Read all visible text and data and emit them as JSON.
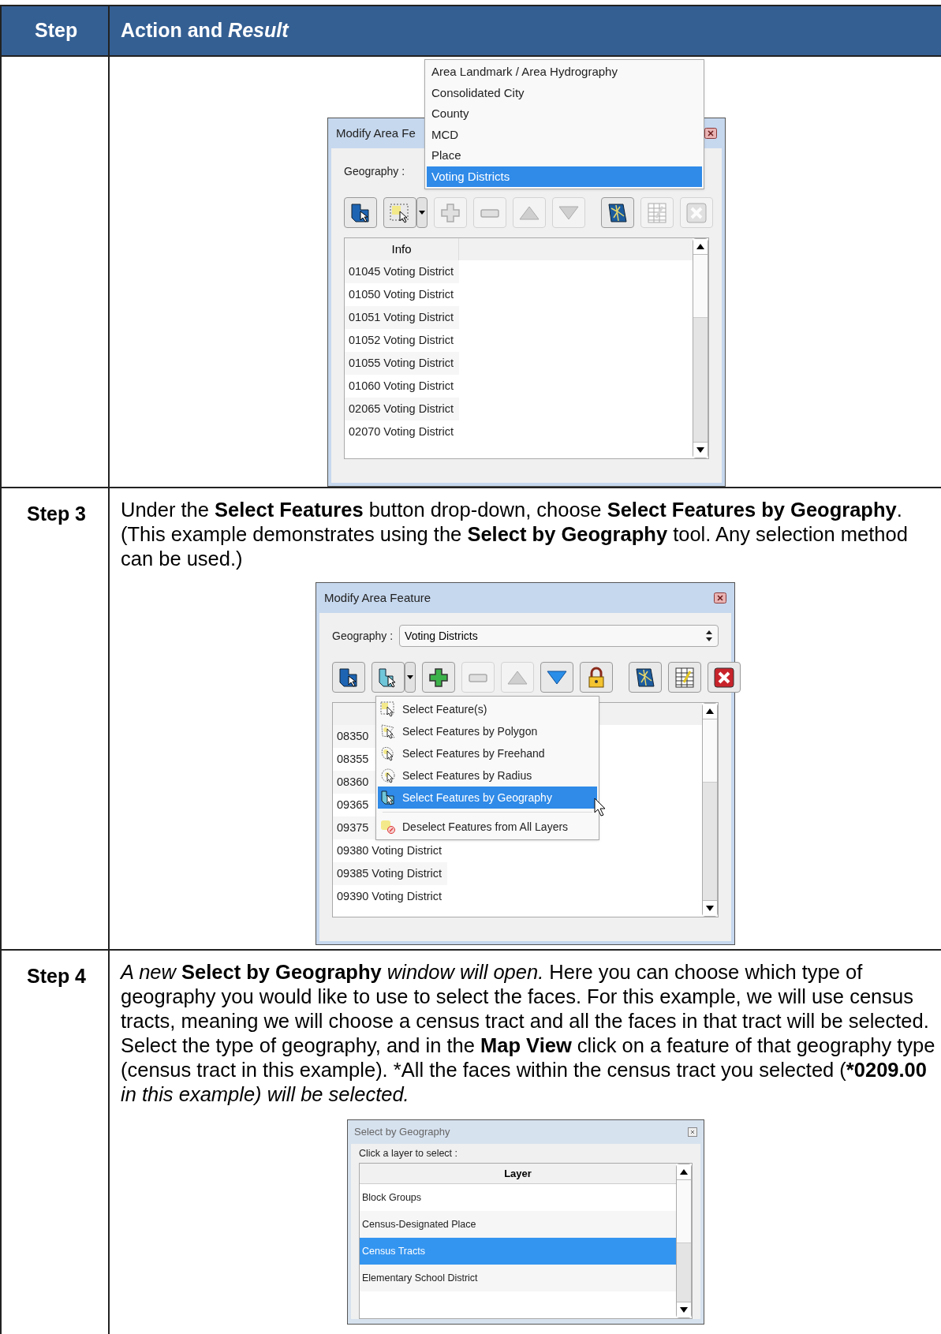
{
  "table": {
    "columns": [
      "Step",
      "Action and *Result*"
    ],
    "rows": [
      {
        "step": "",
        "window": {
          "kind": "feature",
          "title": "Modify Area Fe",
          "geography_label": "Geography :",
          "dropdown": [
            {
              "label": "Area Landmark / Area Hydrography",
              "selected": false
            },
            {
              "label": "Consolidated City",
              "selected": false
            },
            {
              "label": "County",
              "selected": false
            },
            {
              "label": "MCD",
              "selected": false
            },
            {
              "label": "Place",
              "selected": false
            },
            {
              "label": "Voting Districts",
              "selected": true
            }
          ],
          "toolbar": [
            {
              "kind": "geography",
              "disabled": false
            },
            {
              "kind": "select-box-split",
              "disabled": false
            },
            {
              "kind": "add",
              "disabled": true
            },
            {
              "kind": "remove",
              "disabled": true
            },
            {
              "kind": "up",
              "disabled": true
            },
            {
              "kind": "down",
              "disabled": true
            },
            {
              "kind": "map",
              "disabled": false
            },
            {
              "kind": "table",
              "disabled": true
            },
            {
              "kind": "delete",
              "disabled": true
            }
          ],
          "list_header": "Info",
          "list": [
            "01045 Voting District",
            "01050 Voting District",
            "01051 Voting District",
            "01052 Voting District",
            "01055 Voting District",
            "01060 Voting District",
            "02065 Voting District",
            "02070 Voting District"
          ]
        }
      },
      {
        "step": "Step 3",
        "text": "Under the **Select Features** button drop-down, choose **Select Features by Geography**. (This example demonstrates using the **Select by Geography** tool. Any selection method can be used.)",
        "window": {
          "kind": "feature",
          "title": "Modify Area Feature",
          "geography_label": "Geography :",
          "geography_value": "Voting Districts",
          "toolbar": [
            {
              "kind": "geography",
              "disabled": false
            },
            {
              "kind": "select-shape-split",
              "disabled": false
            },
            {
              "kind": "add",
              "disabled": false
            },
            {
              "kind": "remove",
              "disabled": true
            },
            {
              "kind": "up",
              "disabled": true
            },
            {
              "kind": "down",
              "disabled": false
            },
            {
              "kind": "lock",
              "disabled": false
            },
            {
              "kind": "map",
              "disabled": false
            },
            {
              "kind": "table",
              "disabled": false
            },
            {
              "kind": "delete",
              "disabled": false
            }
          ],
          "list": [
            "08350",
            "08355",
            "08360",
            "09365",
            "09375",
            "09380 Voting District",
            "09385 Voting District",
            "09390 Voting District"
          ],
          "menu": [
            {
              "kind": "box",
              "label": "Select Feature(s)",
              "selected": false
            },
            {
              "kind": "polygon",
              "label": "Select Features by Polygon",
              "selected": false
            },
            {
              "kind": "freehand",
              "label": "Select Features by Freehand",
              "selected": false
            },
            {
              "kind": "radius",
              "label": "Select Features by Radius",
              "selected": false
            },
            {
              "kind": "geography",
              "label": "Select Features by Geography",
              "selected": true
            },
            {
              "kind": "deselect",
              "label": "Deselect Features from All Layers",
              "selected": false,
              "divider_above": true
            }
          ]
        }
      },
      {
        "step": "Step 4",
        "text": "*A new* **Select by Geography** *window will open.* Here you can choose which type of geography you would like to use to select the faces. For this example, we will use census tracts, meaning we will choose a census tract and all the faces in that tract will be selected. Select the type of geography, and in the **Map View** click on a feature of that geography type (census tract in this example). *All the faces within the census tract you selected (***0209.00** *in this example) will be selected.*",
        "window": {
          "kind": "layers",
          "title": "Select by Geography",
          "prompt": "Click a layer to select :",
          "list_header": "Layer",
          "layers": [
            {
              "label": "Block Groups",
              "selected": false
            },
            {
              "label": "Census-Designated Place",
              "selected": false
            },
            {
              "label": "Census Tracts",
              "selected": true
            },
            {
              "label": "Elementary School District",
              "selected": false
            }
          ]
        }
      }
    ]
  }
}
